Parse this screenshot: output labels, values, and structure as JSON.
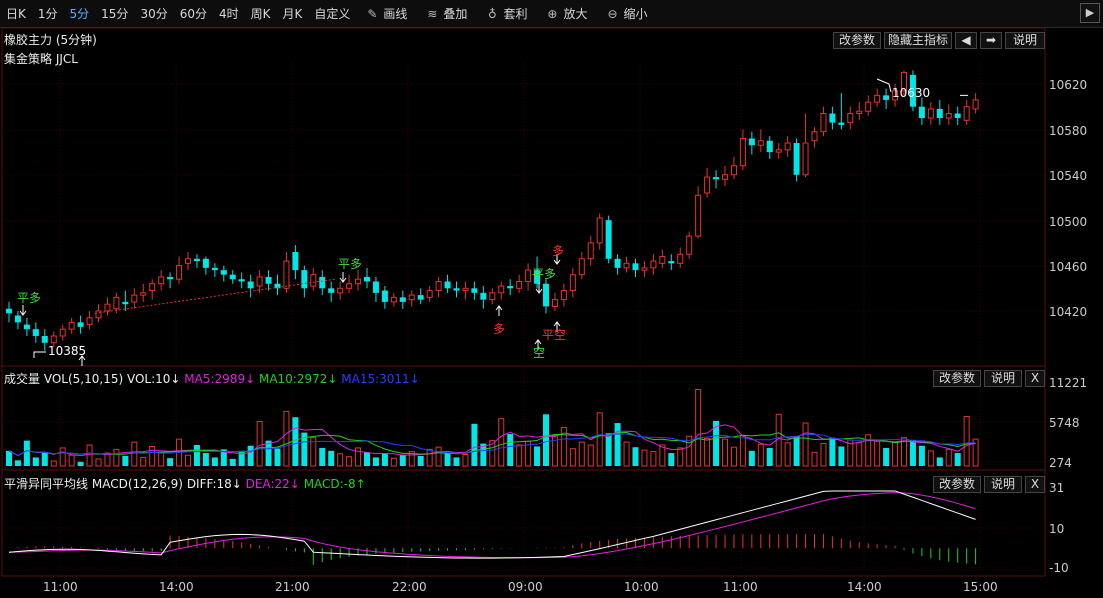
{
  "toolbar": {
    "periods": [
      "日K",
      "1分",
      "5分",
      "15分",
      "30分",
      "60分",
      "4时",
      "周K",
      "月K",
      "自定义"
    ],
    "active_period": "5分",
    "tools": [
      {
        "label": "画线",
        "icon": "pencil-icon"
      },
      {
        "label": "叠加",
        "icon": "layers-icon"
      },
      {
        "label": "套利",
        "icon": "money-bag-icon"
      },
      {
        "label": "放大",
        "icon": "zoom-in-icon"
      },
      {
        "label": "缩小",
        "icon": "zoom-out-icon"
      }
    ],
    "more_arrow": "▶"
  },
  "main_panel": {
    "title": "橡胶主力 (5分钟)",
    "strategy": "集金策略 JJCL",
    "buttons": {
      "params": "改参数",
      "hide_indicator": "隐藏主指标",
      "left": "◀",
      "right": "➡",
      "help": "说明"
    },
    "price_axis": [
      "10620",
      "10580",
      "10540",
      "10500",
      "10460",
      "10420"
    ],
    "high_label": "10630",
    "low_label": "10385",
    "signals": [
      "平多",
      "平多",
      "多",
      "平多",
      "多",
      "空",
      "平空"
    ]
  },
  "volume_panel": {
    "name": "成交量",
    "params": "VOL(5,10,15)",
    "vol": "VOL:10↓",
    "ma5": "MA5:2989↓",
    "ma10": "MA10:2972↓",
    "ma15": "MA15:3011↓",
    "axis": [
      "11221",
      "5748",
      "274"
    ],
    "buttons": {
      "params": "改参数",
      "help": "说明",
      "close": "X"
    }
  },
  "macd_panel": {
    "name": "平滑异同平均线",
    "params": "MACD(12,26,9)",
    "diff": "DIFF:18↓",
    "dea": "DEA:22↓",
    "macd": "MACD:-8↑",
    "axis": [
      "31",
      "10",
      "-10"
    ],
    "buttons": {
      "params": "改参数",
      "help": "说明",
      "close": "X"
    }
  },
  "time_axis": [
    "11:00",
    "14:00",
    "21:00",
    "22:00",
    "09:00",
    "10:00",
    "11:00",
    "14:00",
    "15:00"
  ],
  "colors": {
    "up": "#e8322c",
    "down": "#00e5e5",
    "ma5": "#e020e0",
    "ma10": "#20d020",
    "ma15": "#2040ff",
    "diff": "#ffffff",
    "dea": "#e020e0",
    "grid": "#3a0000",
    "signal_green": "#3ddc3d",
    "signal_red": "#ff3030"
  },
  "chart_data": {
    "type": "candlestick",
    "price_range": [
      10385,
      10630
    ],
    "note_high": 10630,
    "note_low": 10385,
    "volume_range": [
      274,
      11221
    ],
    "macd_range": [
      -10,
      31
    ]
  }
}
